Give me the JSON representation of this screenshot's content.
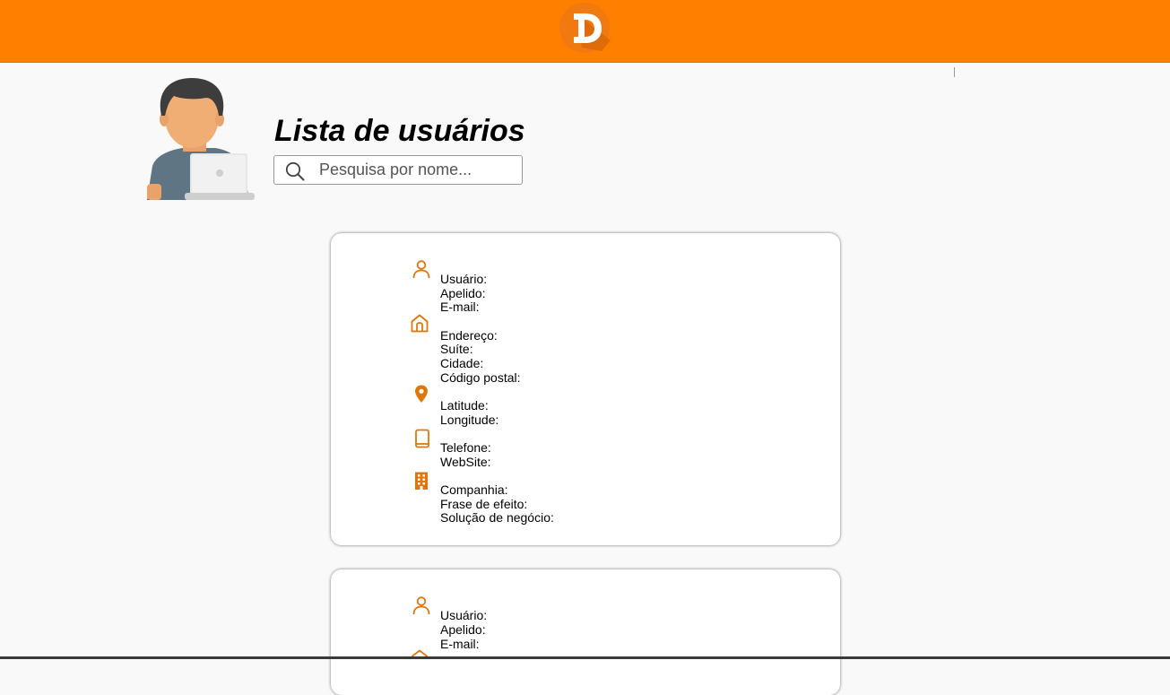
{
  "header": {
    "logo_name": "d-logo",
    "brand_color": "#ff7f00"
  },
  "main": {
    "title": "Lista de usuários",
    "search": {
      "placeholder": "Pesquisa por nome...",
      "value": ""
    }
  },
  "cards": [
    {
      "labels": {
        "user": "Usuário:",
        "nickname": "Apelido:",
        "email": "E-mail:",
        "address": "Endereço:",
        "suite": "Suíte:",
        "city": "Cidade:",
        "zipcode": "Código postal:",
        "latitude": "Latitude:",
        "longitude": "Longitude:",
        "phone": "Telefone:",
        "website": "WebSite:",
        "company": "Companhia:",
        "catchphrase": "Frase de efeito:",
        "business": "Solução de negócio:"
      }
    },
    {
      "labels": {
        "user": "Usuário:",
        "nickname": "Apelido:",
        "email": "E-mail:"
      }
    }
  ],
  "icons": [
    "person-icon",
    "home-icon",
    "location-pin-icon",
    "phone-icon",
    "building-icon",
    "search-icon"
  ],
  "icon_color": "#e0760a"
}
